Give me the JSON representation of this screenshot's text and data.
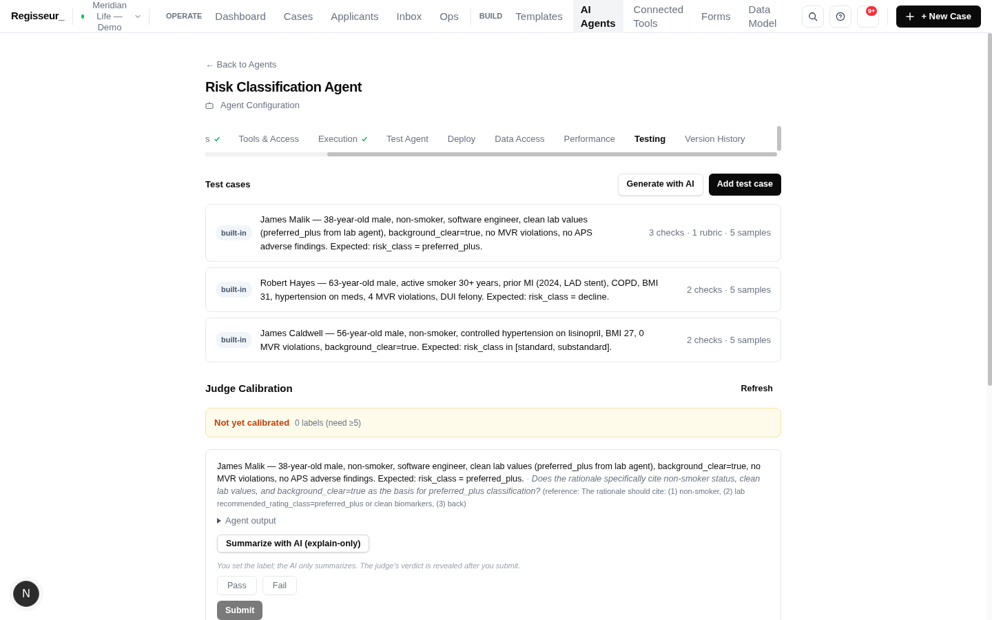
{
  "nav": {
    "brand": "Regisseur_",
    "workspace": "Meridian Life — Demo",
    "groups": [
      {
        "label": "OPERATE",
        "items": [
          {
            "label": "Dashboard",
            "selected": false
          },
          {
            "label": "Cases",
            "selected": false
          },
          {
            "label": "Applicants",
            "selected": false
          },
          {
            "label": "Inbox",
            "selected": false
          },
          {
            "label": "Ops",
            "selected": false
          }
        ]
      },
      {
        "label": "BUILD",
        "items": [
          {
            "label": "Templates",
            "selected": false
          },
          {
            "label": "AI Agents",
            "selected": true
          },
          {
            "label": "Connected Tools",
            "selected": false
          },
          {
            "label": "Forms",
            "selected": false
          },
          {
            "label": "Data Model",
            "selected": false
          }
        ]
      }
    ],
    "notification_badge": "9+",
    "new_case_button": "+ New Case"
  },
  "back_link": "← Back to Agents",
  "title": "Risk Classification Agent",
  "subtitle": "Agent Configuration",
  "tabs": [
    {
      "label": "s",
      "completed": true,
      "selected": false
    },
    {
      "label": "Tools & Access",
      "completed": false,
      "selected": false
    },
    {
      "label": "Execution",
      "completed": true,
      "selected": false
    },
    {
      "label": "Test Agent",
      "completed": false,
      "selected": false
    },
    {
      "label": "Deploy",
      "completed": false,
      "selected": false
    },
    {
      "label": "Data Access",
      "completed": false,
      "selected": false
    },
    {
      "label": "Performance",
      "completed": false,
      "selected": false
    },
    {
      "label": "Testing",
      "completed": false,
      "selected": true
    },
    {
      "label": "Version History",
      "completed": false,
      "selected": false
    }
  ],
  "test_cases": {
    "heading": "Test cases",
    "buttons": [
      {
        "label": "Generate with AI",
        "kind": "secondary"
      },
      {
        "label": "Add test case",
        "kind": "primary"
      }
    ],
    "items": [
      {
        "badge": "built-in",
        "description": "James Malik — 38-year-old male, non-smoker, software engineer, clean lab values (preferred_plus from lab agent), background_clear=true, no MVR violations, no APS adverse findings. Expected: risk_class = preferred_plus.",
        "summary": "3 checks · 1 rubric · 5 samples"
      },
      {
        "badge": "built-in",
        "description": "Robert Hayes — 63-year-old male, active smoker 30+ years, prior MI (2024, LAD stent), COPD, BMI 31, hypertension on meds, 4 MVR violations, DUI felony. Expected: risk_class = decline.",
        "summary": "2 checks · 5 samples"
      },
      {
        "badge": "built-in",
        "description": "James Caldwell — 56-year-old male, non-smoker, controlled hypertension on lisinopril, BMI 27, 0 MVR violations, background_clear=true. Expected: risk_class in [standard, substandard].",
        "summary": "2 checks · 5 samples"
      }
    ]
  },
  "judge_calibration": {
    "heading": "Judge Calibration",
    "refresh_button": "Refresh",
    "status": {
      "label": "Not yet calibrated",
      "detail": "0 labels (need ≥5)"
    },
    "sample": {
      "case_text": "James Malik — 38-year-old male, non-smoker, software engineer, clean lab values (preferred_plus from lab agent), background_clear=true, no MVR violations, no APS adverse findings. Expected: risk_class = preferred_plus.",
      "separator": "·",
      "question": "Does the rationale specifically cite non-smoker status, clean lab values, and background_clear=true as the basis for preferred_plus classification?",
      "reference": "(reference: The rationale should cite: (1) non-smoker, (2) lab recommended_rating_class=preferred_plus or clean biomarkers, (3) back)",
      "agent_output": {
        "label": "Agent output",
        "expanded": false
      },
      "summarize_button": "Summarize with AI (explain-only)",
      "note": "You set the label; the AI only summarizes. The judge’s verdict is revealed after you submit.",
      "verdicts": [
        {
          "label": "Pass",
          "selected": false
        },
        {
          "label": "Fail",
          "selected": false
        }
      ],
      "submit": {
        "label": "Submit",
        "disabled": true
      }
    }
  },
  "dev_indicator": "N"
}
